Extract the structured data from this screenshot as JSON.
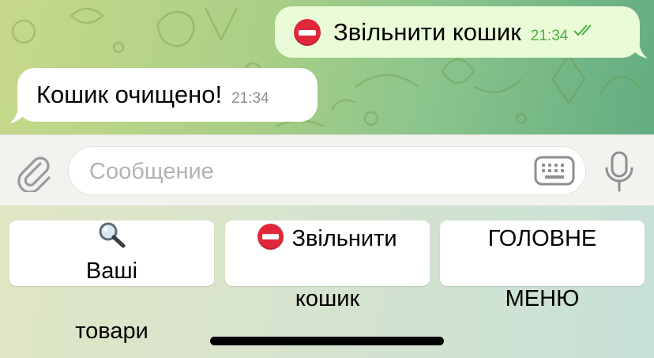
{
  "chat": {
    "outgoing": {
      "text": "Звільнити кошик",
      "emoji": "stop-icon",
      "time": "21:34",
      "status": "read"
    },
    "incoming": {
      "text": "Кошик очищено!",
      "time": "21:34"
    }
  },
  "input": {
    "placeholder": "Сообщение"
  },
  "keyboard": {
    "buttons": [
      {
        "icon": "magnifier-icon",
        "line1": "Ваші",
        "line2": "товари"
      },
      {
        "icon": "stop-icon",
        "line1": "Звільнити",
        "line2": "кошик"
      },
      {
        "icon": "",
        "line1": "ГОЛОВНЕ",
        "line2": "МЕНЮ"
      }
    ]
  },
  "colors": {
    "outgoing_bubble": "#eafbd8",
    "incoming_bubble": "#ffffff",
    "read_check": "#4caf3f",
    "stop_red": "#e0283a"
  }
}
